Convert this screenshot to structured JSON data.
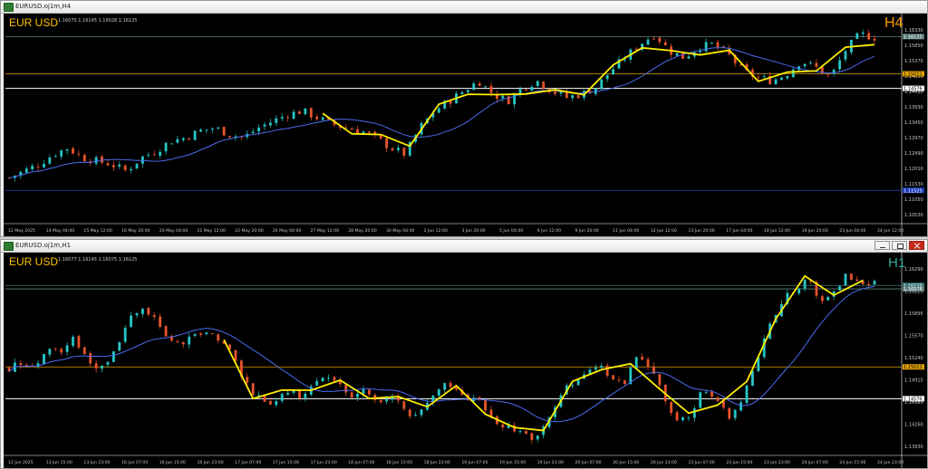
{
  "windows": [
    {
      "title": "EURUSD.oj1m,H4",
      "symbol_label": "EUR USD",
      "ohlc_info": "1.16075 1.16145 1.16028 1.16125",
      "timeframe_label": "H4",
      "price_labels": [
        "1.16330",
        "1.15850",
        "1.15370",
        "1.14890",
        "1.14410",
        "1.13930",
        "1.13450",
        "1.12970",
        "1.12490",
        "1.12010",
        "1.11530",
        "1.11050",
        "1.10530"
      ],
      "marker_labels": [
        {
          "text": "1.16125",
          "bg": "#5f7f7f"
        },
        {
          "text": "1.15011",
          "bg": "#e0a000"
        },
        {
          "text": "1.14576",
          "bg": "#ffffff"
        },
        {
          "text": "1.11525",
          "bg": "#2040c0"
        }
      ],
      "time_labels": [
        "12 May 2025",
        "14 May 04:00",
        "15 May 12:00",
        "16 May 20:00",
        "20 May 04:00",
        "21 May 12:00",
        "22 May 20:00",
        "26 May 04:00",
        "27 May 12:00",
        "28 May 20:00",
        "30 May 04:00",
        "2 Jun 12:00",
        "3 Jun 20:00",
        "5 Jun 04:00",
        "6 Jun 12:00",
        "9 Jun 20:00",
        "11 Jun 04:00",
        "12 Jun 12:00",
        "13 Jun 20:00",
        "17 Jun 04:00",
        "18 Jun 12:00",
        "19 Jun 20:00",
        "23 Jun 04:00",
        "24 Jun 12:00"
      ]
    },
    {
      "title": "EURUSD.oj1m,H1",
      "symbol_label": "EUR USD",
      "ohlc_info": "1.16077 1.16145 1.16075 1.16125",
      "timeframe_label": "H1",
      "price_labels": [
        "1.16290",
        "1.16225",
        "1.15895",
        "1.15570",
        "1.15240",
        "1.14915",
        "1.14585",
        "1.14260",
        "1.13930"
      ],
      "marker_labels": [
        {
          "text": "1.16125",
          "bg": "#3a7a7a"
        },
        {
          "text": "1.16078",
          "bg": "#5f7f7f"
        },
        {
          "text": "1.15011",
          "bg": "#e0a000"
        },
        {
          "text": "1.14576",
          "bg": "#ffffff"
        }
      ],
      "time_labels": [
        "12 Jun 2025",
        "13 Jun 15:00",
        "13 Jun 23:00",
        "16 Jun 07:00",
        "16 Jun 15:00",
        "16 Jun 23:00",
        "17 Jun 07:00",
        "17 Jun 15:00",
        "17 Jun 23:00",
        "18 Jun 07:00",
        "18 Jun 15:00",
        "18 Jun 23:00",
        "19 Jun 07:00",
        "19 Jun 15:00",
        "19 Jun 23:00",
        "20 Jun 07:00",
        "20 Jun 15:00",
        "20 Jun 23:00",
        "23 Jun 07:00",
        "23 Jun 15:00",
        "23 Jun 23:00",
        "24 Jun 07:00",
        "24 Jun 15:00",
        "24 Jun 23:00"
      ]
    }
  ],
  "colors": {
    "bull_candle": "#26c6c6",
    "bear_candle": "#e8542a",
    "zigzag": "#ffee00",
    "moving_average": "#4a6cf0",
    "level_orange": "#e0a000",
    "level_white": "#ffffff",
    "level_blue": "#2040c0",
    "level_grey": "#7f7f7f",
    "symbol_text": "#ffc000",
    "h4_text": "#ff9900",
    "h1_text": "#33aa99"
  },
  "chart_data": [
    {
      "type": "candlestick",
      "title": "EURUSD H4",
      "ylim": [
        1.1053,
        1.1665
      ],
      "level_lines": [
        1.16125,
        1.15011,
        1.14576,
        1.11525
      ],
      "close_profile": [
        1.119,
        1.121,
        1.123,
        1.126,
        1.128,
        1.125,
        1.124,
        1.123,
        1.121,
        1.125,
        1.127,
        1.13,
        1.131,
        1.133,
        1.134,
        1.132,
        1.131,
        1.134,
        1.136,
        1.138,
        1.139,
        1.137,
        1.135,
        1.134,
        1.133,
        1.131,
        1.128,
        1.126,
        1.134,
        1.139,
        1.142,
        1.145,
        1.148,
        1.144,
        1.142,
        1.146,
        1.148,
        1.145,
        1.143,
        1.144,
        1.146,
        1.151,
        1.155,
        1.159,
        1.162,
        1.157,
        1.155,
        1.158,
        1.159,
        1.156,
        1.151,
        1.149,
        1.148,
        1.15,
        1.154,
        1.152,
        1.149,
        1.157,
        1.162,
        1.161
      ]
    },
    {
      "type": "candlestick",
      "title": "EURUSD H1",
      "ylim": [
        1.138,
        1.165
      ],
      "level_lines": [
        1.16225,
        1.16078,
        1.15011,
        1.14576
      ],
      "close_profile": [
        1.15,
        1.151,
        1.15,
        1.153,
        1.152,
        1.154,
        1.151,
        1.15,
        1.152,
        1.156,
        1.158,
        1.157,
        1.154,
        1.153,
        1.154,
        1.155,
        1.154,
        1.152,
        1.148,
        1.146,
        1.145,
        1.147,
        1.146,
        1.147,
        1.149,
        1.148,
        1.146,
        1.147,
        1.145,
        1.146,
        1.145,
        1.143,
        1.146,
        1.148,
        1.147,
        1.146,
        1.145,
        1.143,
        1.142,
        1.141,
        1.14,
        1.143,
        1.146,
        1.148,
        1.149,
        1.15,
        1.149,
        1.148,
        1.152,
        1.15,
        1.146,
        1.142,
        1.144,
        1.147,
        1.145,
        1.143,
        1.146,
        1.151,
        1.156,
        1.159,
        1.161,
        1.162,
        1.159,
        1.161,
        1.163,
        1.161,
        1.162
      ]
    }
  ]
}
